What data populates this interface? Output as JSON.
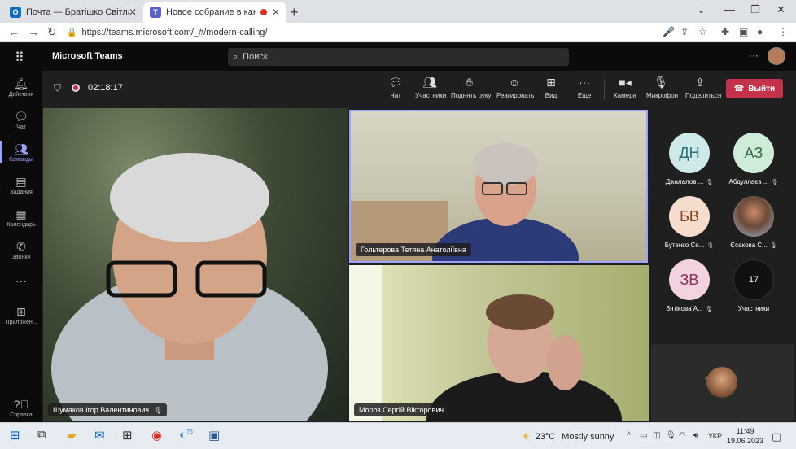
{
  "browser": {
    "tabs": [
      {
        "title": "Почта — Братішко Світлана Ми",
        "favicon": "outlook-icon"
      },
      {
        "title": "Новое собрание в канале (",
        "favicon": "teams-icon",
        "recording": true
      }
    ],
    "url": "https://teams.microsoft.com/_#/modern-calling/"
  },
  "teams": {
    "app_name": "Microsoft Teams",
    "search_placeholder": "Поиск",
    "rail": [
      {
        "label": "Действия",
        "icon": "bell-icon"
      },
      {
        "label": "Чат",
        "icon": "chat-icon"
      },
      {
        "label": "Команды",
        "icon": "teams-icon",
        "active": true
      },
      {
        "label": "Задания",
        "icon": "assignments-icon"
      },
      {
        "label": "Календарь",
        "icon": "calendar-icon"
      },
      {
        "label": "Звонки",
        "icon": "phone-icon"
      },
      {
        "label": "",
        "icon": "more-icon"
      },
      {
        "label": "Приложен...",
        "icon": "apps-icon"
      },
      {
        "label": "Справка",
        "icon": "help-icon"
      }
    ]
  },
  "meeting": {
    "timer": "02:18:17",
    "controls": {
      "chat": "Чат",
      "participants": "Участники",
      "raise_hand": "Поднять руку",
      "react": "Реагировать",
      "view": "Вид",
      "more": "Еще",
      "camera": "Камера",
      "mic": "Микрофон",
      "share": "Поделиться",
      "leave": "Выйти"
    },
    "tiles": [
      {
        "name": "Шумаков Ігор Валентинович"
      },
      {
        "name": "Гольтерова Тетяна Анатоліївна"
      },
      {
        "name": "Мороз Сергій Вікторович"
      }
    ],
    "participants": [
      {
        "initials": "ДН",
        "name": "Джалалов ...",
        "color": "#cfe9eb"
      },
      {
        "initials": "АЗ",
        "name": "Абдуллаєв ...",
        "color": "#cfecd8"
      },
      {
        "initials": "БВ",
        "name": "Бутенко Се...",
        "color": "#f6dccc"
      },
      {
        "initials": "",
        "name": "Єсакова С...",
        "color": "#9b9b9b"
      },
      {
        "initials": "ЗВ",
        "name": "Зятікова А...",
        "color": "#f3d3de"
      },
      {
        "initials": "17",
        "name": "Участники",
        "color": "#111111"
      }
    ]
  },
  "taskbar": {
    "weather_temp": "23°C",
    "weather_cond": "Mostly sunny",
    "lang": "УКР",
    "time": "11:49",
    "date": "19.06.2023",
    "badge": "75"
  }
}
